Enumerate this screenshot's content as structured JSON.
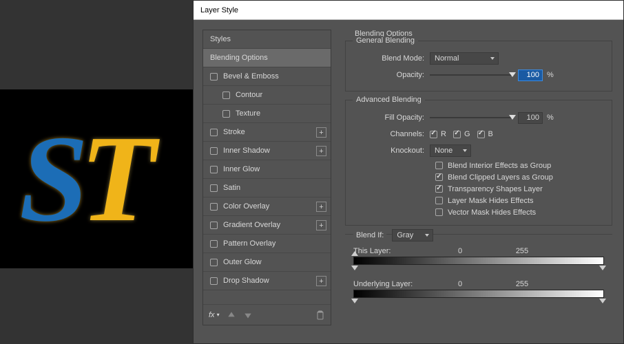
{
  "canvas": {
    "s": "S",
    "t": "T"
  },
  "dialog": {
    "title": "Layer Style",
    "left": {
      "styles": "Styles",
      "blending_options": "Blending Options",
      "bevel": "Bevel & Emboss",
      "contour": "Contour",
      "texture": "Texture",
      "stroke": "Stroke",
      "inner_shadow": "Inner Shadow",
      "inner_glow": "Inner Glow",
      "satin": "Satin",
      "color_overlay": "Color Overlay",
      "gradient_overlay": "Gradient Overlay",
      "pattern_overlay": "Pattern Overlay",
      "outer_glow": "Outer Glow",
      "drop_shadow": "Drop Shadow",
      "fx": "fx"
    },
    "panel_header": "Blending Options",
    "general": {
      "legend": "General Blending",
      "blend_mode_label": "Blend Mode:",
      "blend_mode_value": "Normal",
      "opacity_label": "Opacity:",
      "opacity_value": "100",
      "pct": "%"
    },
    "advanced": {
      "legend": "Advanced Blending",
      "fill_opacity_label": "Fill Opacity:",
      "fill_opacity_value": "100",
      "pct": "%",
      "channels_label": "Channels:",
      "ch_r": "R",
      "ch_g": "G",
      "ch_b": "B",
      "knockout_label": "Knockout:",
      "knockout_value": "None",
      "opt_interior": "Blend Interior Effects as Group",
      "opt_clipped": "Blend Clipped Layers as Group",
      "opt_transparency": "Transparency Shapes Layer",
      "opt_layermask": "Layer Mask Hides Effects",
      "opt_vectormask": "Vector Mask Hides Effects"
    },
    "blendif": {
      "label": "Blend If:",
      "value": "Gray",
      "this_layer": "This Layer:",
      "this_low": "0",
      "this_high": "255",
      "under_layer": "Underlying Layer:",
      "under_low": "0",
      "under_high": "255"
    }
  }
}
